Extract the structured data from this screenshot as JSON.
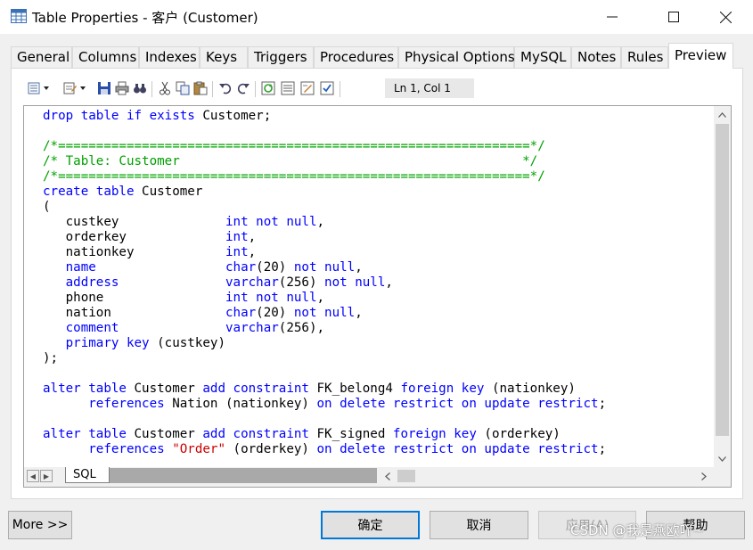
{
  "window": {
    "title": "Table Properties - 客户 (Customer)",
    "minimize_glyph": "—",
    "maximize_glyph": "☐",
    "close_glyph": "✕"
  },
  "tabs": [
    {
      "label": "General"
    },
    {
      "label": "Columns"
    },
    {
      "label": "Indexes"
    },
    {
      "label": "Keys"
    },
    {
      "label": "Triggers"
    },
    {
      "label": "Procedures"
    },
    {
      "label": "Physical Options"
    },
    {
      "label": "MySQL"
    },
    {
      "label": "Notes"
    },
    {
      "label": "Rules"
    },
    {
      "label": "Preview",
      "active": true
    }
  ],
  "toolbar": {
    "icons": [
      "table-menu-icon",
      "edit-menu-icon",
      "save-icon",
      "print-icon",
      "find-icon",
      "cut-icon",
      "copy-icon",
      "paste-icon",
      "undo-icon",
      "redo-icon",
      "refresh-icon",
      "list-icon",
      "edit-icon",
      "checklist-icon"
    ],
    "cursor_position": "Ln 1, Col 1"
  },
  "editor": {
    "sheet_tab": "SQL",
    "lines": [
      [
        {
          "c": "kw",
          "t": "drop table if exists "
        },
        {
          "c": "tx",
          "t": "Customer;"
        }
      ],
      [],
      [
        {
          "c": "cm",
          "t": "/*==============================================================*/"
        }
      ],
      [
        {
          "c": "cm",
          "t": "/* Table: Customer                                             */"
        }
      ],
      [
        {
          "c": "cm",
          "t": "/*==============================================================*/"
        }
      ],
      [
        {
          "c": "kw",
          "t": "create table "
        },
        {
          "c": "tx",
          "t": "Customer"
        }
      ],
      [
        {
          "c": "tx",
          "t": "("
        }
      ],
      [
        {
          "c": "tx",
          "t": "   custkey              "
        },
        {
          "c": "kw",
          "t": "int not null"
        },
        {
          "c": "tx",
          "t": ","
        }
      ],
      [
        {
          "c": "tx",
          "t": "   orderkey             "
        },
        {
          "c": "kw",
          "t": "int"
        },
        {
          "c": "tx",
          "t": ","
        }
      ],
      [
        {
          "c": "tx",
          "t": "   nationkey            "
        },
        {
          "c": "kw",
          "t": "int"
        },
        {
          "c": "tx",
          "t": ","
        }
      ],
      [
        {
          "c": "kw",
          "t": "   name                 char"
        },
        {
          "c": "tx",
          "t": "(20) "
        },
        {
          "c": "kw",
          "t": "not null"
        },
        {
          "c": "tx",
          "t": ","
        }
      ],
      [
        {
          "c": "kw",
          "t": "   address              varchar"
        },
        {
          "c": "tx",
          "t": "(256) "
        },
        {
          "c": "kw",
          "t": "not null"
        },
        {
          "c": "tx",
          "t": ","
        }
      ],
      [
        {
          "c": "tx",
          "t": "   phone                "
        },
        {
          "c": "kw",
          "t": "int not null"
        },
        {
          "c": "tx",
          "t": ","
        }
      ],
      [
        {
          "c": "tx",
          "t": "   nation               "
        },
        {
          "c": "kw",
          "t": "char"
        },
        {
          "c": "tx",
          "t": "(20) "
        },
        {
          "c": "kw",
          "t": "not null"
        },
        {
          "c": "tx",
          "t": ","
        }
      ],
      [
        {
          "c": "kw",
          "t": "   comment              varchar"
        },
        {
          "c": "tx",
          "t": "(256),"
        }
      ],
      [
        {
          "c": "kw",
          "t": "   primary key "
        },
        {
          "c": "tx",
          "t": "(custkey)"
        }
      ],
      [
        {
          "c": "tx",
          "t": ");"
        }
      ],
      [],
      [
        {
          "c": "kw",
          "t": "alter table "
        },
        {
          "c": "tx",
          "t": "Customer "
        },
        {
          "c": "kw",
          "t": "add constraint "
        },
        {
          "c": "tx",
          "t": "FK_belong4 "
        },
        {
          "c": "kw",
          "t": "foreign key "
        },
        {
          "c": "tx",
          "t": "(nationkey)"
        }
      ],
      [
        {
          "c": "kw",
          "t": "      references "
        },
        {
          "c": "tx",
          "t": "Nation (nationkey) "
        },
        {
          "c": "kw",
          "t": "on delete restrict on update restrict"
        },
        {
          "c": "tx",
          "t": ";"
        }
      ],
      [],
      [
        {
          "c": "kw",
          "t": "alter table "
        },
        {
          "c": "tx",
          "t": "Customer "
        },
        {
          "c": "kw",
          "t": "add constraint "
        },
        {
          "c": "tx",
          "t": "FK_signed "
        },
        {
          "c": "kw",
          "t": "foreign key "
        },
        {
          "c": "tx",
          "t": "(orderkey)"
        }
      ],
      [
        {
          "c": "kw",
          "t": "      references "
        },
        {
          "c": "str",
          "t": "\"Order\""
        },
        {
          "c": "tx",
          "t": " (orderkey) "
        },
        {
          "c": "kw",
          "t": "on delete restrict on update restrict"
        },
        {
          "c": "tx",
          "t": ";"
        }
      ]
    ]
  },
  "buttons": {
    "more": "More >>",
    "ok": "确定",
    "cancel": "取消",
    "apply": "应用(A)",
    "help": "帮助"
  },
  "watermark": "CSDN @我是燕欧吖~",
  "colors": {
    "keyword": "#0000ff",
    "comment": "#00a000",
    "string": "#cc0000",
    "focus": "#0078d7"
  }
}
